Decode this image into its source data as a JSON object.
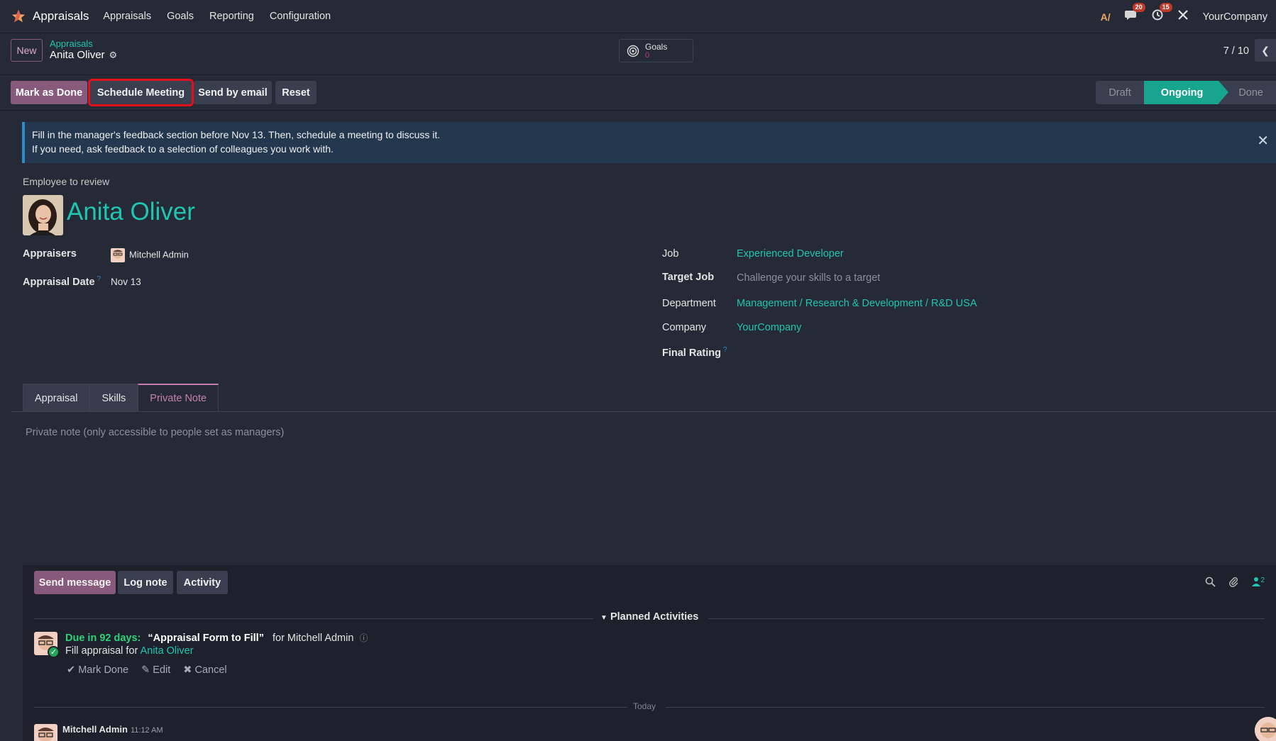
{
  "navbar": {
    "app_name": "Appraisals",
    "menu": [
      "Appraisals",
      "Goals",
      "Reporting",
      "Configuration"
    ],
    "messages_count": "20",
    "activities_count": "15",
    "company": "YourCompany"
  },
  "control": {
    "new_label": "New",
    "breadcrumb_parent": "Appraisals",
    "breadcrumb_current": "Anita Oliver",
    "goals_label": "Goals",
    "goals_value": "0",
    "pager": "7 / 10"
  },
  "status": {
    "buttons": [
      "Mark as Done",
      "Schedule Meeting",
      "Send by email",
      "Reset"
    ],
    "stages": [
      "Draft",
      "Ongoing",
      "Done"
    ],
    "active_stage": "Ongoing"
  },
  "alert": {
    "line1": "Fill in the manager's feedback section before Nov 13. Then, schedule a meeting to discuss it.",
    "line2": "If you need, ask feedback to a selection of colleagues you work with."
  },
  "form": {
    "employee_label": "Employee to review",
    "employee_name": "Anita Oliver",
    "appraisers_label": "Appraisers",
    "appraiser_name": "Mitchell Admin",
    "appraisal_date_label": "Appraisal Date",
    "appraisal_date": "Nov 13",
    "job_label": "Job",
    "job_value": "Experienced Developer",
    "target_job_label": "Target Job",
    "target_job_placeholder": "Challenge your skills to a target",
    "department_label": "Department",
    "department_value": "Management / Research & Development / R&D USA",
    "company_label": "Company",
    "company_value": "YourCompany",
    "final_rating_label": "Final Rating",
    "help_mark": "?"
  },
  "tabs": [
    "Appraisal",
    "Skills",
    "Private Note"
  ],
  "private_note_placeholder": "Private note (only accessible to people set as managers)",
  "chatter": {
    "send_message": "Send message",
    "log_note": "Log note",
    "activity": "Activity",
    "followers_count": "2",
    "planned_title": "Planned Activities",
    "activity_due": "Due in 92 days:",
    "activity_summary": "“Appraisal Form to Fill”",
    "activity_for": "for Mitchell Admin",
    "activity_note_prefix": "Fill appraisal for",
    "activity_note_link": "Anita Oliver",
    "mark_done": "Mark Done",
    "edit": "Edit",
    "cancel": "Cancel",
    "today": "Today",
    "msg_author": "Mitchell Admin",
    "msg_time": "11:12 AM"
  },
  "colors": {
    "primary": "#875a7b",
    "accent": "#1fc5b0",
    "stage_active": "#17a58f",
    "highlight": "#e3101a"
  }
}
